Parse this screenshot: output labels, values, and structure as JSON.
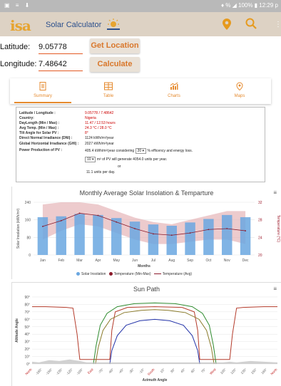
{
  "status_bar": {
    "left_icons": "▣ ≡ ⬇",
    "right": "♦ % ◢ 100% ▮ 12:29 p"
  },
  "app": {
    "logo_text": "isa",
    "title": "Solar Calculator"
  },
  "location": {
    "latitude_label": "Latitude:",
    "latitude_value": "9.05778",
    "longitude_label": "Longitude:",
    "longitude_value": "7.48642",
    "get_location_label": "Get Location",
    "calculate_label": "Calculate"
  },
  "tabs": [
    {
      "label": "Summary",
      "icon": "summary-icon",
      "active": true
    },
    {
      "label": "Table",
      "icon": "table-icon",
      "active": false
    },
    {
      "label": "Charts",
      "icon": "charts-icon",
      "active": false
    },
    {
      "label": "Maps",
      "icon": "maps-icon",
      "active": false
    }
  ],
  "summary": {
    "rows": [
      {
        "key": "Latitude / Longitude :",
        "value": "9.05778 / 7.48642"
      },
      {
        "key": "Country:",
        "value": "Nigeria"
      },
      {
        "key": "DayLength (Min / Max) :",
        "value": "11.47 / 12.53 hours"
      },
      {
        "key": "Avg Temp. (Min / Max) :",
        "value": "24.3 °C / 28.0 °C"
      },
      {
        "key": "Tilt Angle for Solar PV :",
        "value": "8°"
      },
      {
        "key": "Direct Normal Irradiance (DNI) :",
        "value": "1124 kWh/m²/year"
      },
      {
        "key": "Global Horizontal Irradiance (GHI) :",
        "value": "2027 kWh/m²/year"
      },
      {
        "key": "Power Production of PV :",
        "value": "405.4 kWh/m²/year considering"
      }
    ],
    "efficiency_value": "20",
    "efficiency_text": "% efficency and energy loss.",
    "area_value": "10",
    "area_text": "m² of PV will generate 4054.0 units per year.",
    "or_text": "or",
    "per_day_text": "11.1 units per day."
  },
  "insolation_chart": {
    "menu_icon": "menu-icon",
    "chart_data": {
      "type": "bar",
      "title": "Monthly Average Solar Insolation & Temparture",
      "categories": [
        "Jan",
        "Feb",
        "Mar",
        "Apr",
        "May",
        "Jun",
        "Jul",
        "Aug",
        "Sep",
        "Oct",
        "Nov",
        "Dec"
      ],
      "xlabel": "Months",
      "ylabel": "Solar Insolation (kWh/m²)",
      "y2label": "Temperature (°C)",
      "ylim": [
        0,
        240
      ],
      "yticks": [
        "0",
        "80",
        "160",
        "240"
      ],
      "y2lim": [
        20,
        32
      ],
      "y2ticks": [
        "20",
        "24",
        "28",
        "32"
      ],
      "series": [
        {
          "name": "Solar Insolation",
          "type": "bar",
          "color": "#6aa7e0",
          "values": [
            172,
            176,
            187,
            182,
            168,
            152,
            139,
            133,
            148,
            164,
            182,
            172
          ]
        },
        {
          "name": "Temperature (Min-Max)",
          "type": "range",
          "color": "#e5b5b8",
          "low": [
            23.5,
            25.5,
            27,
            26.5,
            25,
            23.5,
            22.5,
            22.5,
            23,
            23.5,
            23.5,
            22.5
          ],
          "high": [
            31.5,
            32,
            32,
            31.5,
            30,
            28.5,
            27.5,
            27,
            28,
            29,
            30,
            30
          ]
        },
        {
          "name": "Temperature (Avg)",
          "type": "line",
          "color": "#8b1a2b",
          "values": [
            26.5,
            27.8,
            29.5,
            29,
            27.5,
            26,
            24.8,
            24.5,
            25,
            25.8,
            26,
            25.5
          ]
        }
      ],
      "legend": "bottom",
      "grid": true
    }
  },
  "sun_path_chart": {
    "menu_icon": "menu-icon",
    "chart_data": {
      "type": "line",
      "title": "Sun Path",
      "xlabel": "Azimuth Angle",
      "ylabel": "Altitude Angle",
      "xticks": [
        "North",
        "-165°",
        "-150°",
        "-135°",
        "-120°",
        "-105°",
        "East",
        "-75°",
        "-60°",
        "-45°",
        "-30°",
        "-15°",
        "South",
        "15°",
        "30°",
        "45°",
        "60°",
        "75°",
        "West",
        "105°",
        "120°",
        "135°",
        "150°",
        "165°",
        "North"
      ],
      "xlim": [
        -180,
        180
      ],
      "yticks": [
        "0°",
        "10°",
        "20°",
        "30°",
        "40°",
        "50°",
        "60°",
        "70°",
        "80°",
        "90°"
      ],
      "ylim": [
        0,
        90
      ],
      "series": [
        {
          "color": "#b43a2a",
          "points": [
            [
              -180,
              77
            ],
            [
              -160,
              77
            ],
            [
              -130,
              76
            ],
            [
              -120,
              75
            ],
            [
              -114,
              40
            ],
            [
              -110,
              6
            ],
            [
              -100,
              6
            ],
            [
              -66,
              6
            ],
            [
              -63,
              45
            ],
            [
              -58,
              70
            ],
            [
              -40,
              76
            ],
            [
              0,
              77
            ],
            [
              40,
              76
            ],
            [
              58,
              70
            ],
            [
              63,
              45
            ],
            [
              66,
              6
            ],
            [
              100,
              6
            ],
            [
              110,
              6
            ],
            [
              114,
              40
            ],
            [
              120,
              75
            ],
            [
              130,
              76
            ],
            [
              160,
              77
            ],
            [
              180,
              77
            ]
          ]
        },
        {
          "color": "#2e8b2e",
          "points": [
            [
              -90,
              0
            ],
            [
              -86,
              25
            ],
            [
              -80,
              52
            ],
            [
              -70,
              68
            ],
            [
              -55,
              77
            ],
            [
              -30,
              81
            ],
            [
              0,
              82
            ],
            [
              30,
              81
            ],
            [
              55,
              77
            ],
            [
              70,
              68
            ],
            [
              80,
              52
            ],
            [
              86,
              25
            ],
            [
              90,
              0
            ]
          ]
        },
        {
          "color": "#8a7a2a",
          "points": [
            [
              -87,
              0
            ],
            [
              -83,
              22
            ],
            [
              -76,
              45
            ],
            [
              -65,
              60
            ],
            [
              -45,
              69
            ],
            [
              -20,
              72
            ],
            [
              0,
              73
            ],
            [
              20,
              72
            ],
            [
              45,
              69
            ],
            [
              65,
              60
            ],
            [
              76,
              45
            ],
            [
              83,
              22
            ],
            [
              87,
              0
            ]
          ]
        },
        {
          "color": "#2232a8",
          "points": [
            [
              -66,
              0
            ],
            [
              -63,
              18
            ],
            [
              -55,
              38
            ],
            [
              -42,
              52
            ],
            [
              -22,
              58
            ],
            [
              0,
              60
            ],
            [
              22,
              58
            ],
            [
              42,
              52
            ],
            [
              55,
              38
            ],
            [
              63,
              18
            ],
            [
              66,
              0
            ]
          ]
        },
        {
          "color": "#888888",
          "points": [
            [
              -180,
              3
            ],
            [
              -170,
              2
            ],
            [
              -155,
              5
            ],
            [
              -140,
              4
            ],
            [
              -125,
              6
            ],
            [
              -110,
              4
            ],
            [
              -100,
              2
            ],
            [
              100,
              2
            ],
            [
              110,
              3
            ],
            [
              120,
              2
            ],
            [
              140,
              4
            ],
            [
              160,
              3
            ],
            [
              180,
              2
            ]
          ]
        }
      ],
      "grid": true
    }
  },
  "insolation_legend": [
    "Solar Insolation",
    "Temperature (Min-Max)",
    "Temperature (Avg)"
  ]
}
